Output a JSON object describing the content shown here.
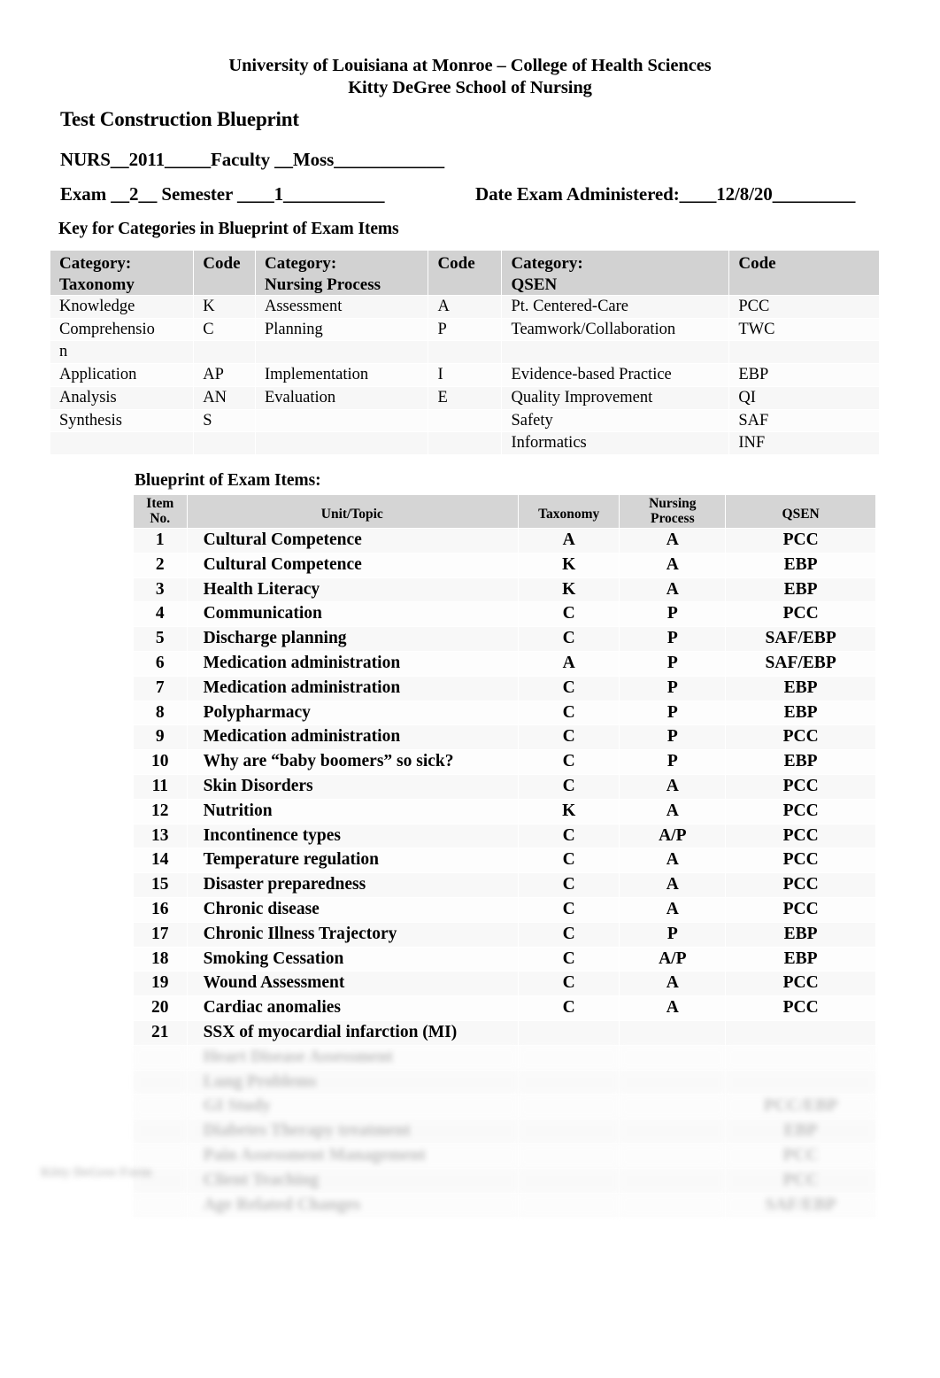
{
  "header": {
    "line1": "University of Louisiana at Monroe – College of Health Sciences",
    "line2": "Kitty DeGree School of Nursing",
    "title": "Test Construction Blueprint",
    "course_line": "NURS__2011_____Faculty __Moss____________",
    "exam_line": "Exam __2__ Semester ____1___________",
    "date_line": "Date Exam Administered:____12/8/20_________"
  },
  "key_section": {
    "heading": "Key for Categories in Blueprint of Exam Items",
    "headers": {
      "cat_taxonomy_l1": "Category:",
      "cat_taxonomy_l2": "Taxonomy",
      "code1": "Code",
      "cat_process_l1": "Category:",
      "cat_process_l2": "Nursing Process",
      "code2": "Code",
      "cat_qsen_l1": "Category:",
      "cat_qsen_l2": "QSEN",
      "code3": "Code"
    },
    "rows": [
      {
        "taxonomy": "Knowledge",
        "code1": "K",
        "process": "Assessment",
        "code2": "A",
        "qsen": "Pt. Centered-Care",
        "code3": "PCC"
      },
      {
        "taxonomy": "Comprehensio",
        "code1": "C",
        "process": "Planning",
        "code2": "P",
        "qsen": "Teamwork/Collaboration",
        "code3": "TWC"
      },
      {
        "taxonomy": "n",
        "code1": "",
        "process": "",
        "code2": "",
        "qsen": "",
        "code3": ""
      },
      {
        "taxonomy": "Application",
        "code1": "AP",
        "process": "Implementation",
        "code2": "I",
        "qsen": "Evidence-based Practice",
        "code3": "EBP"
      },
      {
        "taxonomy": "Analysis",
        "code1": "AN",
        "process": "Evaluation",
        "code2": "E",
        "qsen": "Quality Improvement",
        "code3": "QI"
      },
      {
        "taxonomy": "Synthesis",
        "code1": "S",
        "process": "",
        "code2": "",
        "qsen": "Safety",
        "code3": "SAF"
      },
      {
        "taxonomy": "",
        "code1": "",
        "process": "",
        "code2": "",
        "qsen": "Informatics",
        "code3": "INF"
      }
    ]
  },
  "blueprint": {
    "heading": "Blueprint of Exam Items:",
    "headers": {
      "item_no_l1": "Item",
      "item_no_l2": "No.",
      "unit_topic": "Unit/Topic",
      "taxonomy": "Taxonomy",
      "nursing_process_l1": "Nursing",
      "nursing_process_l2": "Process",
      "qsen": "QSEN"
    },
    "rows": [
      {
        "no": "1",
        "topic": "Cultural Competence",
        "taxonomy": "A",
        "process": "A",
        "qsen": "PCC"
      },
      {
        "no": "2",
        "topic": "Cultural Competence",
        "taxonomy": "K",
        "process": "A",
        "qsen": "EBP"
      },
      {
        "no": "3",
        "topic": "Health Literacy",
        "taxonomy": "K",
        "process": "A",
        "qsen": "EBP"
      },
      {
        "no": "4",
        "topic": "Communication",
        "taxonomy": "C",
        "process": "P",
        "qsen": "PCC"
      },
      {
        "no": "5",
        "topic": "Discharge planning",
        "taxonomy": "C",
        "process": "P",
        "qsen": "SAF/EBP"
      },
      {
        "no": "6",
        "topic": "Medication administration",
        "taxonomy": "A",
        "process": "P",
        "qsen": "SAF/EBP"
      },
      {
        "no": "7",
        "topic": "Medication administration",
        "taxonomy": "C",
        "process": "P",
        "qsen": "EBP"
      },
      {
        "no": "8",
        "topic": "Polypharmacy",
        "taxonomy": "C",
        "process": "P",
        "qsen": "EBP"
      },
      {
        "no": "9",
        "topic": "Medication administration",
        "taxonomy": "C",
        "process": "P",
        "qsen": "PCC"
      },
      {
        "no": "10",
        "topic": "Why are “baby boomers” so sick?",
        "taxonomy": "C",
        "process": "P",
        "qsen": "EBP"
      },
      {
        "no": "11",
        "topic": "Skin Disorders",
        "taxonomy": "C",
        "process": "A",
        "qsen": "PCC"
      },
      {
        "no": "12",
        "topic": "Nutrition",
        "taxonomy": "K",
        "process": "A",
        "qsen": "PCC"
      },
      {
        "no": "13",
        "topic": "Incontinence types",
        "taxonomy": "C",
        "process": "A/P",
        "qsen": "PCC"
      },
      {
        "no": "14",
        "topic": "Temperature regulation",
        "taxonomy": "C",
        "process": "A",
        "qsen": "PCC"
      },
      {
        "no": "15",
        "topic": "Disaster preparedness",
        "taxonomy": "C",
        "process": "A",
        "qsen": "PCC"
      },
      {
        "no": "16",
        "topic": "Chronic disease",
        "taxonomy": "C",
        "process": "A",
        "qsen": "PCC"
      },
      {
        "no": "17",
        "topic": "Chronic Illness Trajectory",
        "taxonomy": "C",
        "process": "P",
        "qsen": "EBP"
      },
      {
        "no": "18",
        "topic": "Smoking Cessation",
        "taxonomy": "C",
        "process": "A/P",
        "qsen": "EBP"
      },
      {
        "no": "19",
        "topic": "Wound Assessment",
        "taxonomy": "C",
        "process": "A",
        "qsen": "PCC"
      },
      {
        "no": "20",
        "topic": "Cardiac anomalies",
        "taxonomy": "C",
        "process": "A",
        "qsen": "PCC"
      },
      {
        "no": "21",
        "topic": "SSX of myocardial infarction (MI)",
        "taxonomy": "",
        "process": "",
        "qsen": ""
      }
    ],
    "redacted_rows": [
      {
        "no": "",
        "topic": "Heart Disease Assessment",
        "taxonomy": "",
        "process": "",
        "qsen": ""
      },
      {
        "no": "",
        "topic": "Lung Problems",
        "taxonomy": "",
        "process": "",
        "qsen": ""
      },
      {
        "no": "",
        "topic": "GI Study",
        "taxonomy": "",
        "process": "",
        "qsen": "PCC/EBP"
      },
      {
        "no": "",
        "topic": "Diabetes Therapy treatment",
        "taxonomy": "",
        "process": "",
        "qsen": "EBP"
      },
      {
        "no": "",
        "topic": "Pain Assessment Management",
        "taxonomy": "",
        "process": "",
        "qsen": "PCC"
      },
      {
        "no": "",
        "topic": "Client Teaching",
        "taxonomy": "",
        "process": "",
        "qsen": "PCC"
      },
      {
        "no": "",
        "topic": "Age Related Changes",
        "taxonomy": "",
        "process": "",
        "qsen": "SAF/EBP"
      }
    ]
  },
  "footer": {
    "note": "Kitty DeGree Form"
  }
}
